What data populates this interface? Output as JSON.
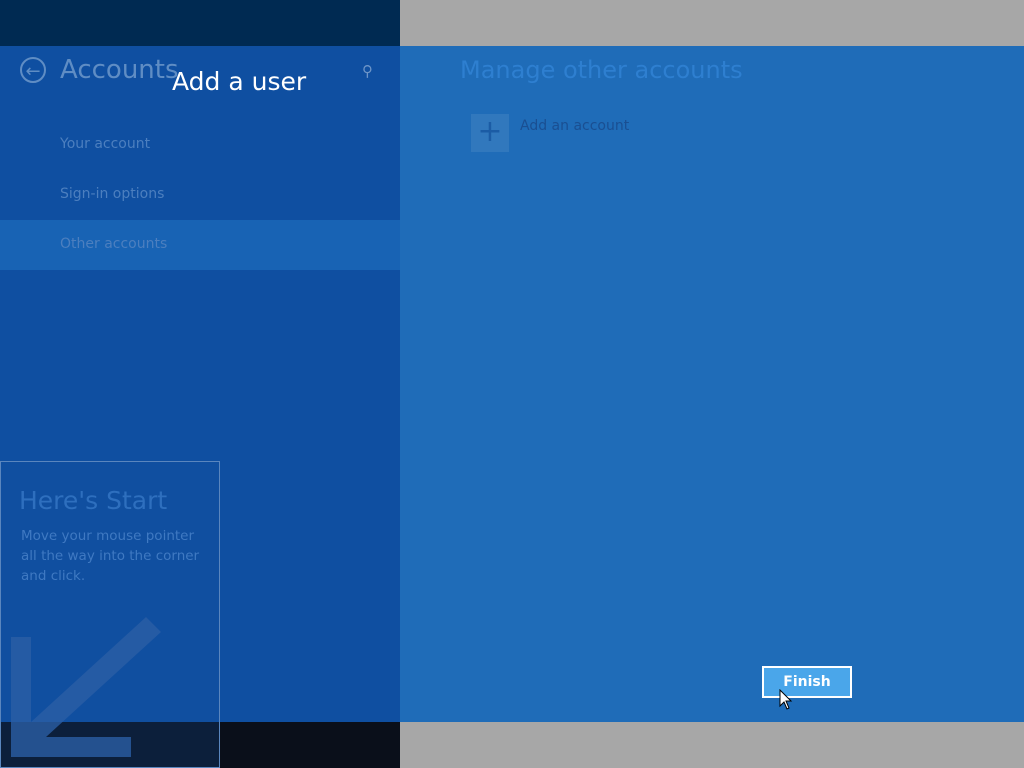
{
  "settings": {
    "app_title": "Accounts",
    "nav": [
      {
        "label": "Your account",
        "selected": false
      },
      {
        "label": "Sign-in options",
        "selected": false
      },
      {
        "label": "Other accounts",
        "selected": true
      }
    ],
    "section_title": "Manage other accounts",
    "add_account_label": "Add an account",
    "add_icon": "+"
  },
  "hint": {
    "title": "Here's Start",
    "text": "Move your mouse pointer all the way into the corner and click."
  },
  "wizard": {
    "heading": "Add a user",
    "finish_label": "Finish"
  },
  "colors": {
    "accent": "#4aa6ea",
    "panel_left": "#0f4fa1",
    "panel_right": "#1f6cb8"
  }
}
